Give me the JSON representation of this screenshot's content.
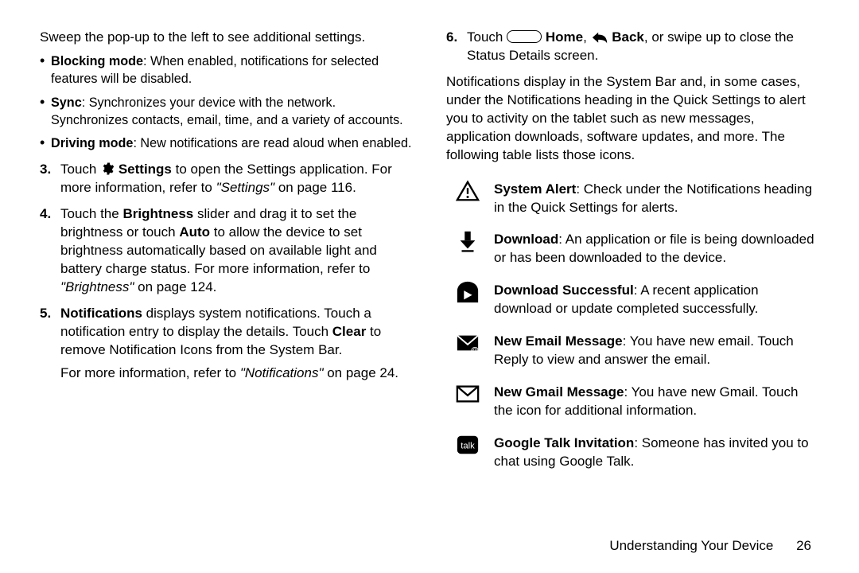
{
  "left": {
    "intro": "Sweep the pop-up to the left to see additional settings.",
    "bullets": [
      {
        "title": "Blocking mode",
        "desc": ": When enabled, notifications for selected features will be disabled."
      },
      {
        "title": "Sync",
        "desc": ": Synchronizes your device with the network. Synchronizes contacts, email, time, and a variety of accounts."
      },
      {
        "title": "Driving mode",
        "desc": ": New notifications are read aloud when enabled."
      }
    ],
    "steps": {
      "s3": {
        "num": "3.",
        "pre": "Touch ",
        "settings_word": " Settings",
        "after": " to open the Settings application. For more information, refer to ",
        "ref": "\"Settings\"",
        "ref_tail": " on page 116."
      },
      "s4": {
        "num": "4.",
        "l1a": "Touch the ",
        "l1b": "Brightness",
        "l1c": " slider and drag it to set the brightness or touch ",
        "l1d": "Auto",
        "l1e": " to allow the device to set brightness automatically based on available light and battery charge status. For more information, refer to ",
        "ref": "\"Brightness\"",
        "ref_tail": " on page 124."
      },
      "s5": {
        "num": "5.",
        "l1a": "Notifications",
        "l1b": " displays system notifications. Touch a notification entry to display the details. Touch ",
        "l1c": "Clear",
        "l1d": " to remove Notification Icons from the System Bar.",
        "more": "For more information, refer to ",
        "ref": "\"Notifications\"",
        "ref_tail": " on page 24."
      }
    }
  },
  "right": {
    "s6": {
      "num": "6.",
      "pre": "Touch ",
      "home_word": " Home",
      "mid": ", ",
      "back_word": " Back",
      "post": ", or swipe up to close the Status Details screen."
    },
    "para": "Notifications display in the System Bar and, in some cases, under the Notifications heading in the Quick Settings to alert you to activity on the tablet such as new messages, application downloads, software updates, and more. The following table lists those icons.",
    "rows": [
      {
        "icon": "system-alert-icon",
        "title": "System Alert",
        "desc": ": Check under the Notifications heading in the Quick Settings for alerts."
      },
      {
        "icon": "download-icon",
        "title": "Download",
        "desc": ": An application or file is being downloaded or has been downloaded to the device."
      },
      {
        "icon": "download-successful-icon",
        "title": "Download Successful",
        "desc": ": A recent application download or update completed successfully."
      },
      {
        "icon": "new-email-message-icon",
        "title": "New Email Message",
        "desc": ": You have new email. Touch Reply to view and answer the email."
      },
      {
        "icon": "new-gmail-message-icon",
        "title": "New Gmail Message",
        "desc": ": You have new Gmail. Touch the icon for additional information."
      },
      {
        "icon": "google-talk-invitation-icon",
        "title": "Google Talk Invitation",
        "desc": ": Someone has invited you to chat using Google Talk."
      }
    ]
  },
  "footer": {
    "section": "Understanding Your Device",
    "page": "26"
  }
}
